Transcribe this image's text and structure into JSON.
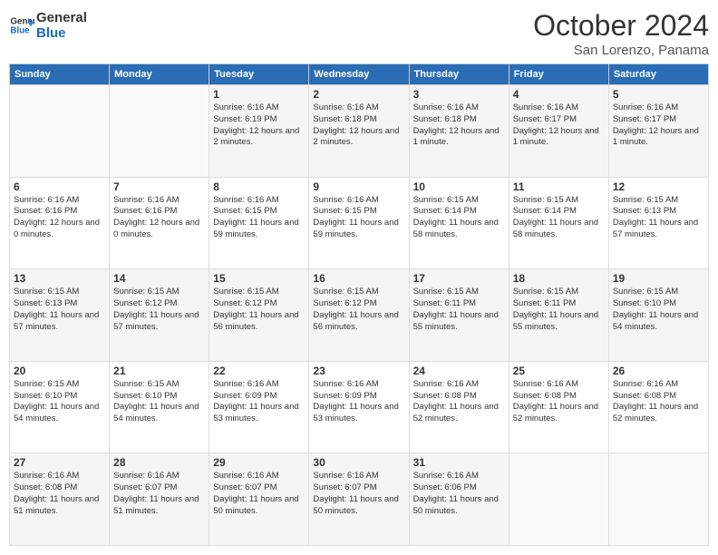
{
  "logo": {
    "line1": "General",
    "line2": "Blue"
  },
  "title": "October 2024",
  "subtitle": "San Lorenzo, Panama",
  "days_header": [
    "Sunday",
    "Monday",
    "Tuesday",
    "Wednesday",
    "Thursday",
    "Friday",
    "Saturday"
  ],
  "weeks": [
    [
      {
        "day": "",
        "info": ""
      },
      {
        "day": "",
        "info": ""
      },
      {
        "day": "1",
        "info": "Sunrise: 6:16 AM\nSunset: 6:19 PM\nDaylight: 12 hours and 2 minutes."
      },
      {
        "day": "2",
        "info": "Sunrise: 6:16 AM\nSunset: 6:18 PM\nDaylight: 12 hours and 2 minutes."
      },
      {
        "day": "3",
        "info": "Sunrise: 6:16 AM\nSunset: 6:18 PM\nDaylight: 12 hours and 1 minute."
      },
      {
        "day": "4",
        "info": "Sunrise: 6:16 AM\nSunset: 6:17 PM\nDaylight: 12 hours and 1 minute."
      },
      {
        "day": "5",
        "info": "Sunrise: 6:16 AM\nSunset: 6:17 PM\nDaylight: 12 hours and 1 minute."
      }
    ],
    [
      {
        "day": "6",
        "info": "Sunrise: 6:16 AM\nSunset: 6:16 PM\nDaylight: 12 hours and 0 minutes."
      },
      {
        "day": "7",
        "info": "Sunrise: 6:16 AM\nSunset: 6:16 PM\nDaylight: 12 hours and 0 minutes."
      },
      {
        "day": "8",
        "info": "Sunrise: 6:16 AM\nSunset: 6:15 PM\nDaylight: 11 hours and 59 minutes."
      },
      {
        "day": "9",
        "info": "Sunrise: 6:16 AM\nSunset: 6:15 PM\nDaylight: 11 hours and 59 minutes."
      },
      {
        "day": "10",
        "info": "Sunrise: 6:15 AM\nSunset: 6:14 PM\nDaylight: 11 hours and 58 minutes."
      },
      {
        "day": "11",
        "info": "Sunrise: 6:15 AM\nSunset: 6:14 PM\nDaylight: 11 hours and 58 minutes."
      },
      {
        "day": "12",
        "info": "Sunrise: 6:15 AM\nSunset: 6:13 PM\nDaylight: 11 hours and 57 minutes."
      }
    ],
    [
      {
        "day": "13",
        "info": "Sunrise: 6:15 AM\nSunset: 6:13 PM\nDaylight: 11 hours and 57 minutes."
      },
      {
        "day": "14",
        "info": "Sunrise: 6:15 AM\nSunset: 6:12 PM\nDaylight: 11 hours and 57 minutes."
      },
      {
        "day": "15",
        "info": "Sunrise: 6:15 AM\nSunset: 6:12 PM\nDaylight: 11 hours and 56 minutes."
      },
      {
        "day": "16",
        "info": "Sunrise: 6:15 AM\nSunset: 6:12 PM\nDaylight: 11 hours and 56 minutes."
      },
      {
        "day": "17",
        "info": "Sunrise: 6:15 AM\nSunset: 6:11 PM\nDaylight: 11 hours and 55 minutes."
      },
      {
        "day": "18",
        "info": "Sunrise: 6:15 AM\nSunset: 6:11 PM\nDaylight: 11 hours and 55 minutes."
      },
      {
        "day": "19",
        "info": "Sunrise: 6:15 AM\nSunset: 6:10 PM\nDaylight: 11 hours and 54 minutes."
      }
    ],
    [
      {
        "day": "20",
        "info": "Sunrise: 6:15 AM\nSunset: 6:10 PM\nDaylight: 11 hours and 54 minutes."
      },
      {
        "day": "21",
        "info": "Sunrise: 6:15 AM\nSunset: 6:10 PM\nDaylight: 11 hours and 54 minutes."
      },
      {
        "day": "22",
        "info": "Sunrise: 6:16 AM\nSunset: 6:09 PM\nDaylight: 11 hours and 53 minutes."
      },
      {
        "day": "23",
        "info": "Sunrise: 6:16 AM\nSunset: 6:09 PM\nDaylight: 11 hours and 53 minutes."
      },
      {
        "day": "24",
        "info": "Sunrise: 6:16 AM\nSunset: 6:08 PM\nDaylight: 11 hours and 52 minutes."
      },
      {
        "day": "25",
        "info": "Sunrise: 6:16 AM\nSunset: 6:08 PM\nDaylight: 11 hours and 52 minutes."
      },
      {
        "day": "26",
        "info": "Sunrise: 6:16 AM\nSunset: 6:08 PM\nDaylight: 11 hours and 52 minutes."
      }
    ],
    [
      {
        "day": "27",
        "info": "Sunrise: 6:16 AM\nSunset: 6:08 PM\nDaylight: 11 hours and 51 minutes."
      },
      {
        "day": "28",
        "info": "Sunrise: 6:16 AM\nSunset: 6:07 PM\nDaylight: 11 hours and 51 minutes."
      },
      {
        "day": "29",
        "info": "Sunrise: 6:16 AM\nSunset: 6:07 PM\nDaylight: 11 hours and 50 minutes."
      },
      {
        "day": "30",
        "info": "Sunrise: 6:16 AM\nSunset: 6:07 PM\nDaylight: 11 hours and 50 minutes."
      },
      {
        "day": "31",
        "info": "Sunrise: 6:16 AM\nSunset: 6:06 PM\nDaylight: 11 hours and 50 minutes."
      },
      {
        "day": "",
        "info": ""
      },
      {
        "day": "",
        "info": ""
      }
    ]
  ]
}
